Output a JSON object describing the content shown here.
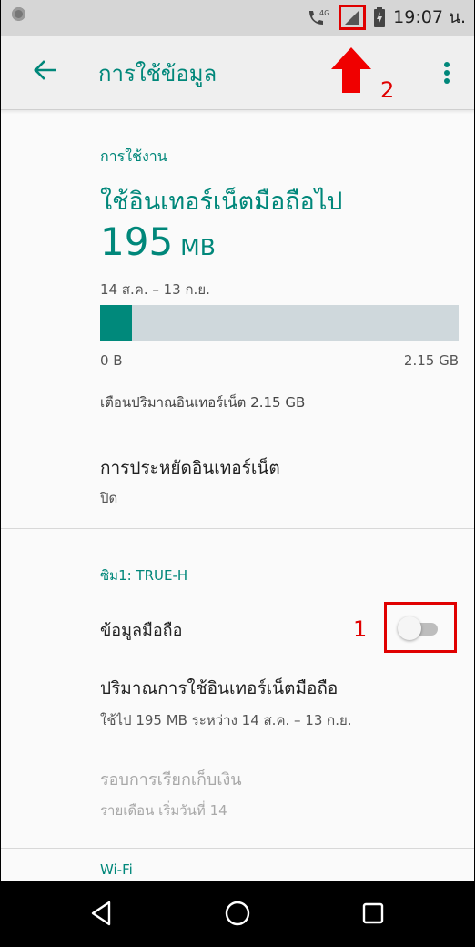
{
  "status_bar": {
    "network_badge": "4G",
    "time": "19:07 น.",
    "icons": [
      "notification-dot-icon",
      "call-4g-icon",
      "signal-icon",
      "battery-charging-icon"
    ]
  },
  "app_bar": {
    "title": "การใช้ข้อมูล",
    "icons": [
      "back-arrow-icon",
      "more-vert-icon"
    ]
  },
  "annotations": {
    "label_1": "1",
    "label_2": "2",
    "color": "#e00000"
  },
  "usage": {
    "section_label": "การใช้งาน",
    "title": "ใช้อินเทอร์เน็ตมือถือไป",
    "amount": "195",
    "unit": "MB",
    "period": "14 ส.ค. – 13 ก.ย.",
    "bar_min": "0 B",
    "bar_max": "2.15 GB",
    "bar_fraction": 0.09,
    "warning": "เตือนปริมาณอินเทอร์เน็ต 2.15 GB"
  },
  "data_saver": {
    "title": "การประหยัดอินเทอร์เน็ต",
    "value": "ปิด"
  },
  "sim": {
    "header": "ซิม1: TRUE-H",
    "mobile_data_label": "ข้อมูลมือถือ",
    "mobile_data_enabled": false,
    "usage_title": "ปริมาณการใช้อินเทอร์เน็ตมือถือ",
    "usage_sub": "ใช้ไป 195 MB ระหว่าง 14 ส.ค. – 13 ก.ย.",
    "billing_title": "รอบการเรียกเก็บเงิน",
    "billing_sub": "รายเดือน เริ่มวันที่ 14"
  },
  "wifi": {
    "header_peek": "Wi-Fi"
  },
  "colors": {
    "accent": "#00877a",
    "bar_fill": "#00897b",
    "bar_track": "#cfd8dc"
  },
  "nav_bar": {
    "icons": [
      "back-triangle-icon",
      "home-circle-icon",
      "recents-square-icon"
    ]
  }
}
